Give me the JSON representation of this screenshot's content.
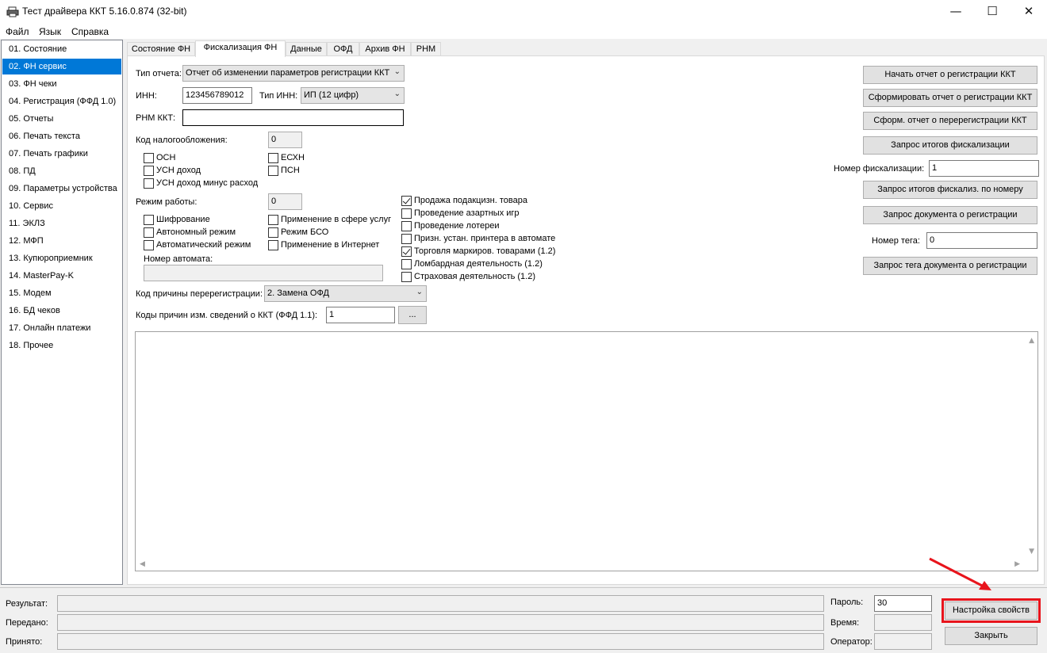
{
  "window": {
    "title": "Тест драйвера ККТ 5.16.0.874 (32-bit)",
    "minimize_glyph": "—",
    "maximize_glyph": "☐",
    "close_glyph": "✕"
  },
  "menu": {
    "file": "Файл",
    "language": "Язык",
    "help": "Справка"
  },
  "sidebar": {
    "items": [
      "01. Состояние",
      "02. ФН сервис",
      "03. ФН чеки",
      "04. Регистрация (ФФД 1.0)",
      "05. Отчеты",
      "06. Печать текста",
      "07. Печать графики",
      "08. ПД",
      "09. Параметры устройства",
      "10. Сервис",
      "11. ЭКЛЗ",
      "12. МФП",
      "13. Купюроприемник",
      "14. MasterPay-K",
      "15. Модем",
      "16. БД чеков",
      "17. Онлайн платежи",
      "18. Прочее"
    ],
    "selected_index": 1
  },
  "tabs": [
    "Состояние ФН",
    "Фискализация ФН",
    "Данные",
    "ОФД",
    "Архив ФН",
    "РНМ"
  ],
  "form": {
    "report_type_label": "Тип отчета:",
    "report_type_value": "Отчет об изменении параметров регистрации ККТ",
    "inn_label": "ИНН:",
    "inn_value": "123456789012",
    "inn_type_label": "Тип ИНН:",
    "inn_type_value": "ИП (12 цифр)",
    "rnm_label": "РНМ ККТ:",
    "rnm_value": "",
    "tax_label": "Код налогообложения:",
    "tax_value": "0",
    "tax_options": [
      {
        "label": "ОСН",
        "checked": false
      },
      {
        "label": "ЕСХН",
        "checked": false
      },
      {
        "label": "УСН доход",
        "checked": false
      },
      {
        "label": "ПСН",
        "checked": false
      },
      {
        "label": "УСН доход минус расход",
        "checked": false
      }
    ],
    "mode_label": "Режим работы:",
    "mode_value": "0",
    "mode_options": [
      {
        "label": "Шифрование",
        "checked": false
      },
      {
        "label": "Применение в сфере услуг",
        "checked": false
      },
      {
        "label": "Автономный режим",
        "checked": false
      },
      {
        "label": "Режим БСО",
        "checked": false
      },
      {
        "label": "Автоматический режим",
        "checked": false
      },
      {
        "label": "Применение в Интернет",
        "checked": false
      }
    ],
    "automat_label": "Номер автомата:",
    "automat_value": "",
    "extra_options": [
      {
        "label": "Продажа подакцизн. товара",
        "checked": true
      },
      {
        "label": "Проведение азартных игр",
        "checked": false
      },
      {
        "label": "Проведение лотереи",
        "checked": false
      },
      {
        "label": "Призн. устан. принтера в автомате",
        "checked": false
      },
      {
        "label": "Торговля маркиров. товарами (1.2)",
        "checked": true
      },
      {
        "label": "Ломбардная деятельность (1.2)",
        "checked": false
      },
      {
        "label": "Страховая деятельность (1.2)",
        "checked": false
      }
    ],
    "reason_label": "Код причины перерегистрации:",
    "reason_value": "2. Замена ОФД",
    "reasons_label": "Коды причин изм. сведений о ККТ (ФФД 1.1):",
    "reasons_value": "1",
    "reasons_button": "..."
  },
  "right_panel": {
    "btn_start_report": "Начать отчет о регистрации ККТ",
    "btn_form_report": "Сформировать отчет о регистрации ККТ",
    "btn_rereg_report": "Сформ. отчет о перерегистрации ККТ",
    "btn_fisc_totals": "Запрос итогов фискализации",
    "fisc_number_label": "Номер фискализации:",
    "fisc_number_value": "1",
    "btn_fisc_by_number": "Запрос итогов фискализ. по номеру",
    "btn_reg_document": "Запрос документа о регистрации",
    "tag_label": "Номер тега:",
    "tag_value": "0",
    "btn_tag_document": "Запрос тега документа о регистрации"
  },
  "log": {
    "scroll_up": "▲",
    "scroll_down": "▼",
    "scroll_left": "◀",
    "scroll_right": "▶"
  },
  "status": {
    "result_label": "Результат:",
    "sent_label": "Передано:",
    "received_label": "Принято:",
    "password_label": "Пароль:",
    "password_value": "30",
    "time_label": "Время:",
    "operator_label": "Оператор:",
    "settings_button": "Настройка свойств",
    "close_button": "Закрыть"
  },
  "colors": {
    "selection": "#0078d7",
    "highlight": "#e8141c"
  }
}
